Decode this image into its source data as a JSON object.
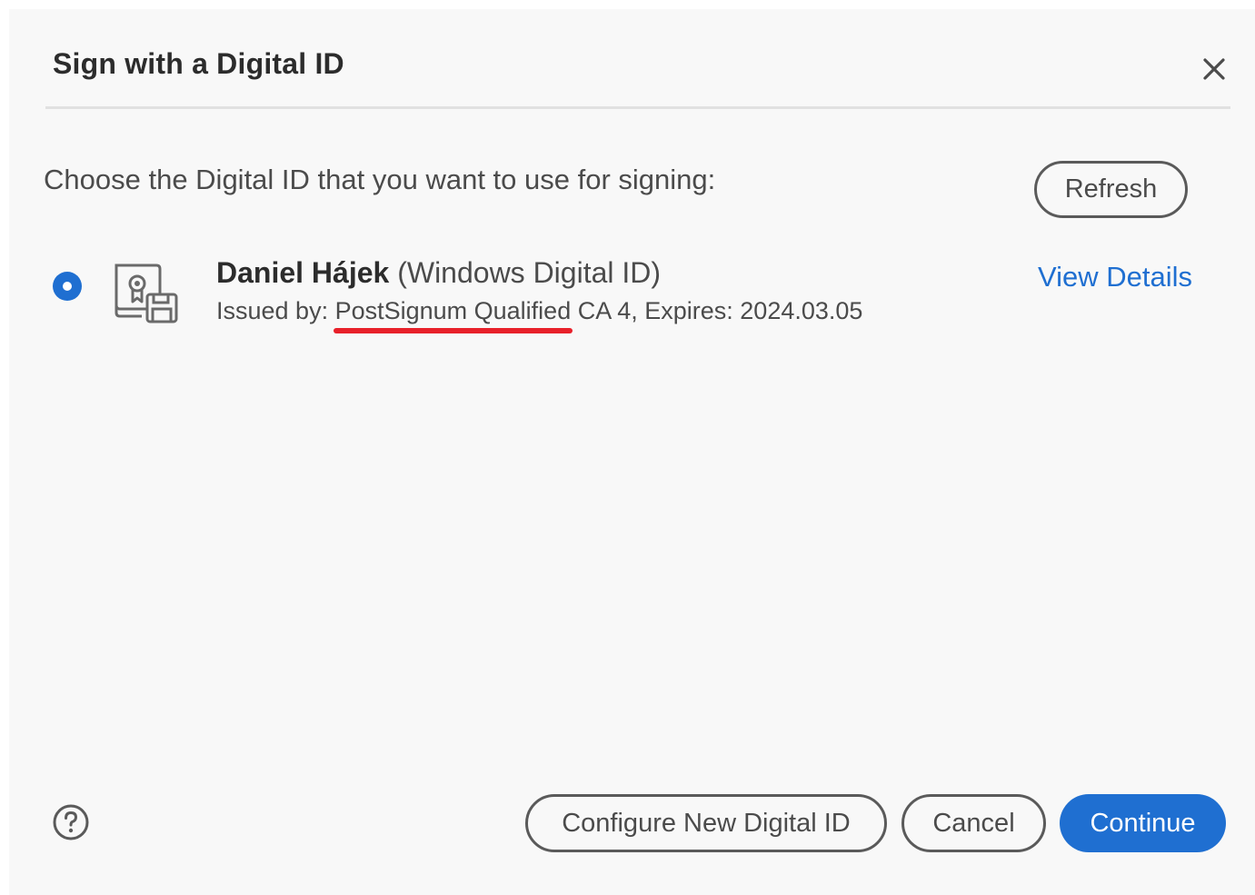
{
  "dialog": {
    "title": "Sign with a Digital ID",
    "close_icon": "close-icon"
  },
  "main": {
    "prompt": "Choose the Digital ID that you want to use for signing:",
    "refresh_label": "Refresh",
    "digital_ids": [
      {
        "selected": true,
        "icon": "digital-id-certificate-icon",
        "name": "Daniel Hájek",
        "type": "(Windows Digital ID)",
        "issued_prefix": "Issued by: ",
        "issuer_highlighted": "PostSignum Qualified",
        "issuer_rest": " CA 4, Expires: 2024.03.05",
        "view_details_label": "View Details"
      }
    ]
  },
  "footer": {
    "help_icon": "help-icon",
    "configure_label": "Configure New Digital ID",
    "cancel_label": "Cancel",
    "continue_label": "Continue"
  },
  "colors": {
    "accent": "#1f6fd1",
    "annotation_underline": "#e8202a",
    "dialog_background": "#f8f8f8"
  }
}
